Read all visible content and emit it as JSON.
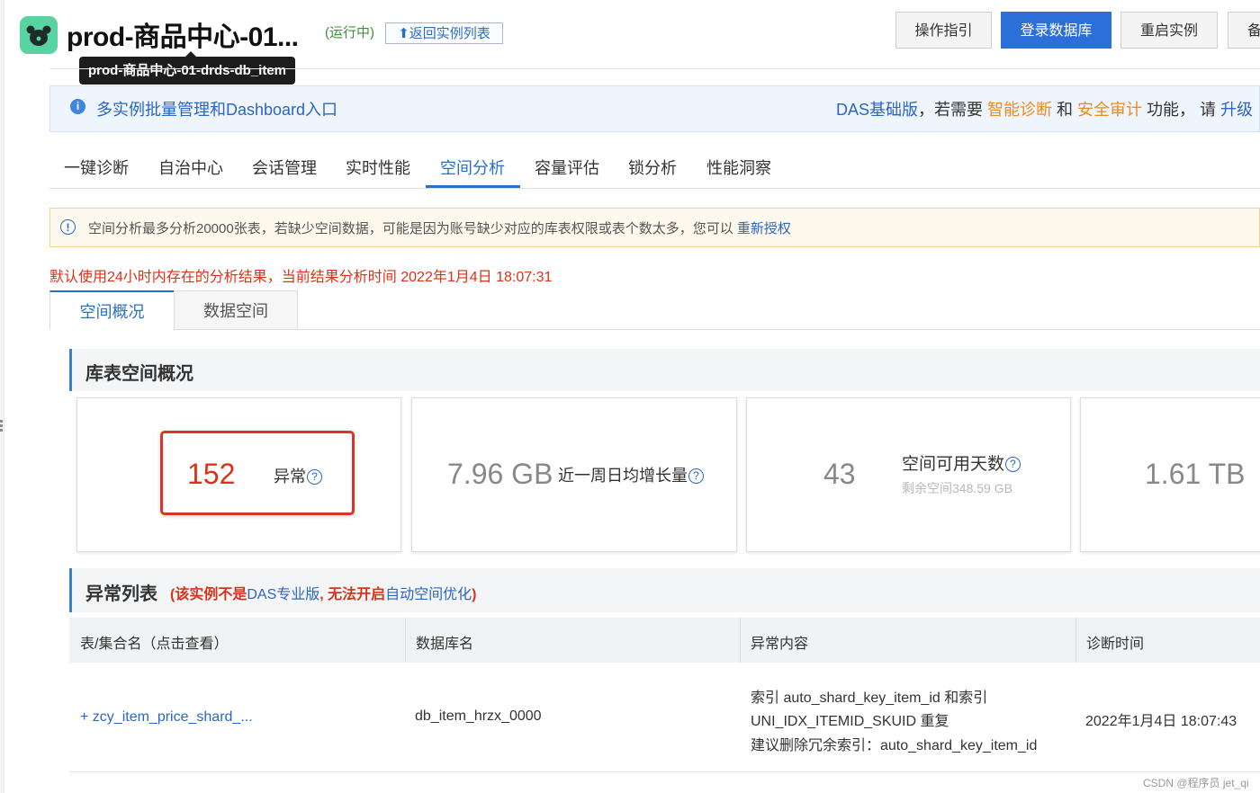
{
  "header": {
    "title": "prod-商品中心-01...",
    "status": "(运行中)",
    "back_label": "⬆返回实例列表",
    "tooltip": "prod-商品中心-01-drds-db_item",
    "buttons": [
      "操作指引",
      "登录数据库",
      "重启实例",
      "备"
    ]
  },
  "banner": {
    "link": "多实例批量管理和Dashboard入口",
    "right_prefix": "DAS基础版",
    "right_mid1": "，若需要 ",
    "right_feature1": "智能诊断",
    "right_mid2": " 和 ",
    "right_feature2": "安全审计",
    "right_mid3": " 功能， 请 ",
    "right_action": "升级"
  },
  "tabs": [
    "一键诊断",
    "自治中心",
    "会话管理",
    "实时性能",
    "空间分析",
    "容量评估",
    "锁分析",
    "性能洞察"
  ],
  "active_tab": "空间分析",
  "warning": {
    "text": "空间分析最多分析20000张表，若缺少空间数据，可能是因为账号缺少对应的库表权限或表个数太多，您可以 ",
    "link": "重新授权"
  },
  "notice": "默认使用24小时内存在的分析结果，当前结果分析时间 2022年1月4日 18:07:31",
  "subtabs": [
    "空间概况",
    "数据空间"
  ],
  "overview": {
    "title": "库表空间概况",
    "cards": [
      {
        "value": "152",
        "label": "异常"
      },
      {
        "value": "7.96 GB",
        "label": "近一周日均增长量"
      },
      {
        "value": "43",
        "label": "空间可用天数",
        "sub": "剩余空间348.59 GB"
      },
      {
        "value": "1.61 TB",
        "label": ""
      }
    ]
  },
  "anomaly": {
    "title": "异常列表",
    "note_prefix": "(该实例不是",
    "note_blue1": "DAS专业版",
    "note_mid": ", 无法开启",
    "note_blue2": "自动空间优化",
    "note_suffix": ")",
    "columns": [
      "表/集合名（点击查看）",
      "数据库名",
      "异常内容",
      "诊断时间"
    ],
    "rows": [
      {
        "table": "+ zcy_item_price_shard_...",
        "db": "db_item_hrzx_0000",
        "content": [
          "索引 auto_shard_key_item_id 和索引",
          "UNI_IDX_ITEMID_SKUID 重复",
          "建议删除冗余索引：auto_shard_key_item_id"
        ],
        "time": "2022年1月4日 18:07:43"
      }
    ]
  },
  "watermark": "CSDN @程序员 jet_qi",
  "colors": {
    "accent": "#2d6fd8",
    "error": "#d9331a",
    "app_icon": "#5ad3a3",
    "warn_border": "#f3d58c"
  }
}
